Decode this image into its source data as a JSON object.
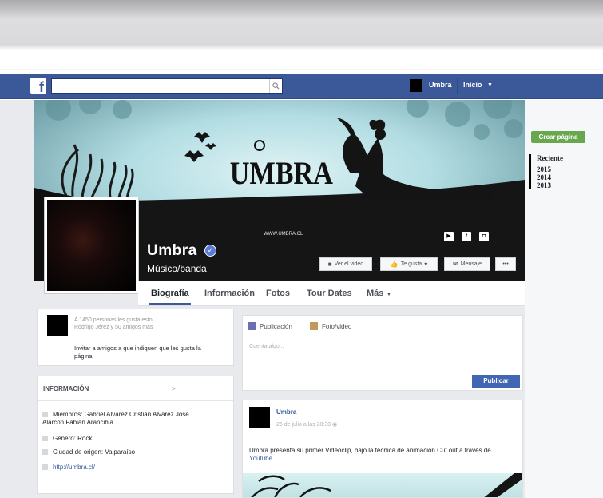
{
  "topbar": {
    "logo": "f",
    "search_placeholder": "",
    "user_name": "Umbra",
    "home_label": "Inicio"
  },
  "cover": {
    "band_logo": "UMBRA",
    "url": "WWW.UMBRA.CL",
    "social_icons": [
      "youtube-icon",
      "twitter-icon",
      "instagram-icon"
    ]
  },
  "profile": {
    "name": "Umbra",
    "category": "Músico/banda"
  },
  "buttons": {
    "watch_video": "Ver el video",
    "like": "Te gusta",
    "message": "Mensaje",
    "more": "•••"
  },
  "tabs": [
    "Biografía",
    "Información",
    "Fotos",
    "Tour Dates",
    "Más"
  ],
  "right_rail": {
    "create_page": "Crear página",
    "recent": "Reciente",
    "years": [
      "2015",
      "2014",
      "2013"
    ]
  },
  "likes": {
    "line1": "A 1450 personas les gusta esto",
    "line2": "Rodrigo Jérez y 50 amigos más",
    "invite": "Invitar a amigos a que indiquen que les gusta la página"
  },
  "info": {
    "title": "INFORMACIÓN",
    "arrow": ">",
    "members_label": "Miembros:",
    "members": "Gabriel Alvarez Cristián Alvarez Jose Alarcón Fabian Arancibia",
    "genre": "Género: Rock",
    "origin": "Ciudad de origen: Valparaíso",
    "website": "http://umbra.cl/"
  },
  "composer": {
    "option_post": "Publicación",
    "option_media": "Foto/video",
    "placeholder": "Cuenta algo...",
    "publish": "Publicar",
    "colors": {
      "post": "#6b6fb0",
      "media": "#c09a5b"
    }
  },
  "post": {
    "author": "Umbra",
    "date": "26 de julio a las 20:30",
    "text": "Umbra presenta su primer Videoclip, bajo la técnica de animación Cut out a través de",
    "link": "Youtube"
  },
  "colors": {
    "facebook_blue": "#3b5998",
    "create_page_green": "#69a74e",
    "publish_blue": "#4267b2",
    "cover_sky": "#b8dfe4"
  }
}
